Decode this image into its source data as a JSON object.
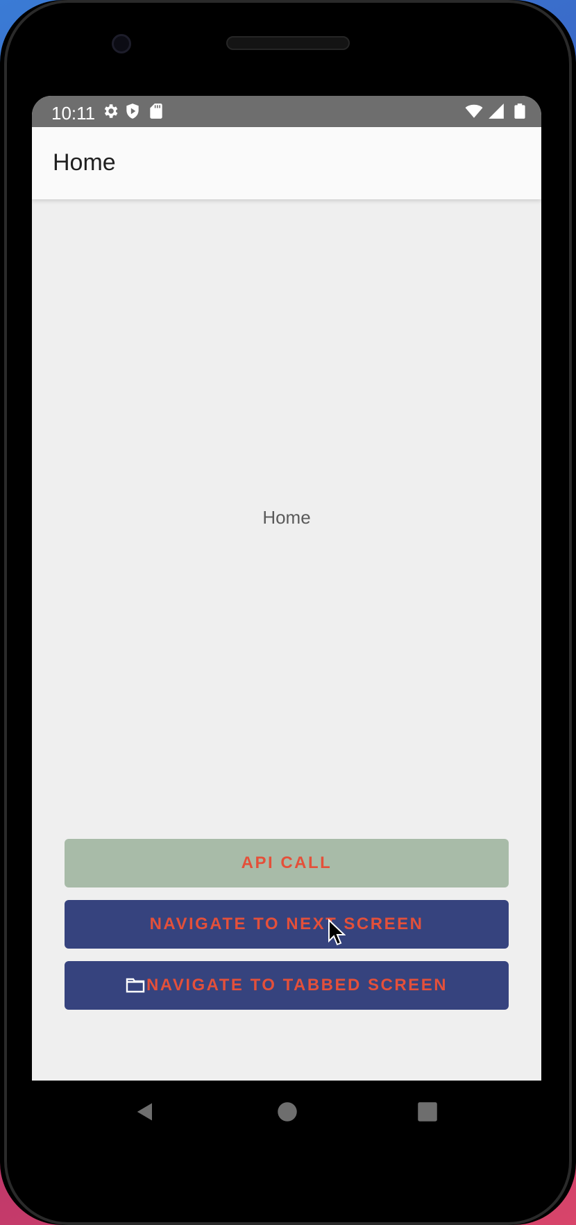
{
  "status_bar": {
    "time": "10:11",
    "left_icons": [
      "gear-icon",
      "shield-play-icon",
      "sd-card-icon"
    ],
    "right_icons": [
      "wifi-icon",
      "cell-signal-icon",
      "battery-icon"
    ]
  },
  "app_bar": {
    "title": "Home"
  },
  "content": {
    "center_text": "Home"
  },
  "buttons": {
    "api_call": "API CALL",
    "navigate_next": "NAVIGATE TO NEXT SCREEN",
    "navigate_tabbed": "NAVIGATE TO TABBED SCREEN",
    "tabbed_icon": "folder-icon"
  },
  "nav_bar": {
    "icons": [
      "back-icon",
      "home-icon",
      "recents-icon"
    ]
  },
  "colors": {
    "status_bar": "#6e6e6e",
    "app_bar": "#fafafa",
    "background": "#efefef",
    "api_button": "#a8bba8",
    "primary_button": "#36437e",
    "button_text": "#e4503a"
  }
}
